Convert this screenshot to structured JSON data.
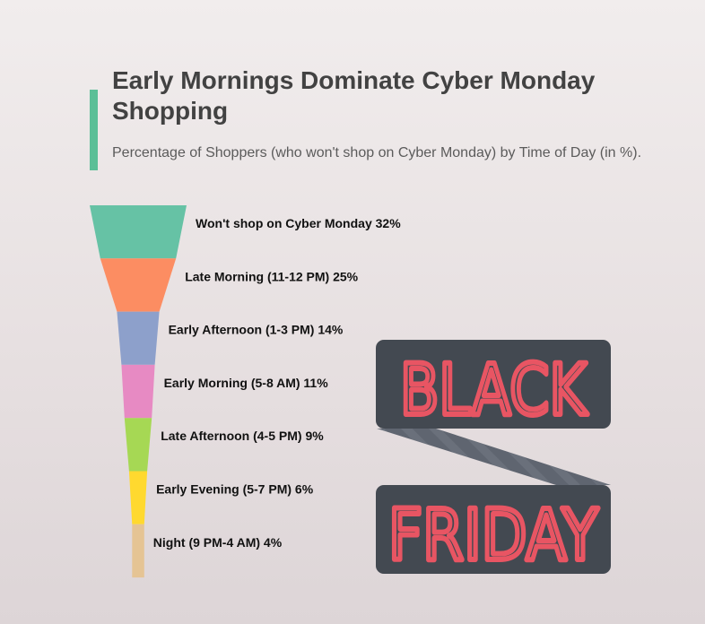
{
  "title": "Early Mornings Dominate Cyber Monday Shopping",
  "subtitle": "Percentage of Shoppers (who won't shop on Cyber Monday) by Time of Day (in %).",
  "accent_color": "#5bbf97",
  "chart_data": {
    "type": "funnel",
    "title": "Early Mornings Dominate Cyber Monday Shopping",
    "subtitle": "Percentage of Shoppers (who won't shop on Cyber Monday) by Time of Day (in %).",
    "unit": "%",
    "categories": [
      "Won't shop on Cyber Monday",
      "Late Morning (11-12 PM)",
      "Early Afternoon (1-3 PM)",
      "Early Morning (5-8 AM)",
      "Late Afternoon (4-5 PM)",
      "Early Evening (5-7 PM)",
      "Night (9 PM-4 AM)"
    ],
    "values": [
      32,
      25,
      14,
      11,
      9,
      6,
      4
    ],
    "labels": [
      "Won't shop on Cyber Monday 32%",
      "Late Morning (11-12 PM) 25%",
      "Early Afternoon (1-3 PM) 14%",
      "Early Morning (5-8 AM) 11%",
      "Late Afternoon (4-5 PM) 9%",
      "Early Evening (5-7 PM) 6%",
      "Night (9 PM-4 AM) 4%"
    ],
    "colors": [
      "#66c2a5",
      "#fc8d62",
      "#8da0cb",
      "#e78ac3",
      "#a6d854",
      "#ffd92f",
      "#e5c494"
    ]
  },
  "illustration": {
    "icon": "black-friday-sign-icon",
    "top_word": "BLACK",
    "bottom_word": "FRIDAY",
    "panel_color": "#434951",
    "ribbon_color": "#5f6570",
    "text_color": "#e85563"
  }
}
